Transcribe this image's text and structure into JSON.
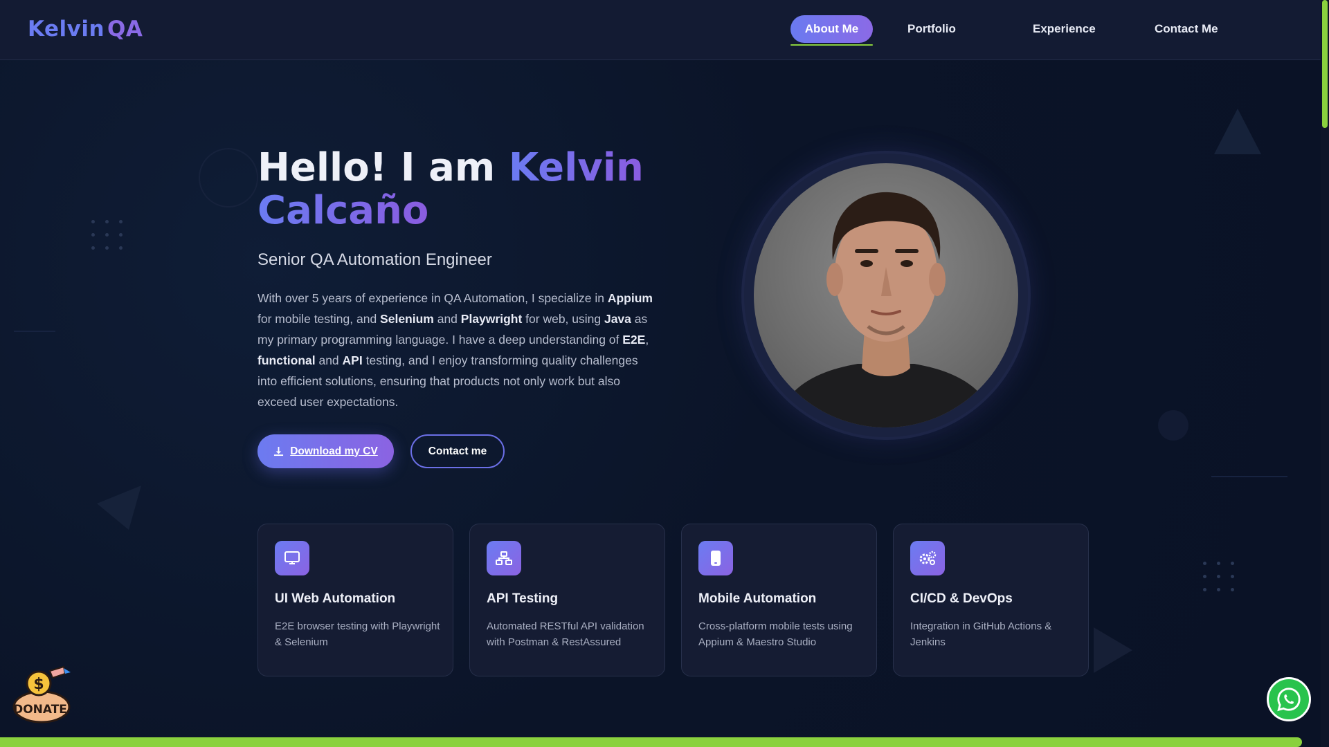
{
  "header": {
    "logo_part1": "Kelvin",
    "logo_part2": "QA",
    "nav": [
      {
        "label": "About Me",
        "active": true
      },
      {
        "label": "Portfolio",
        "active": false
      },
      {
        "label": "Experience",
        "active": false
      },
      {
        "label": "Contact Me",
        "active": false
      }
    ]
  },
  "hero": {
    "greeting": "Hello! I am ",
    "name_first": "Kelvin",
    "name_last": "Calcaño",
    "subtitle": "Senior QA Automation Engineer",
    "bio": [
      {
        "t": "With over 5 years of experience in QA Automation, I specialize in ",
        "b": false
      },
      {
        "t": "Appium",
        "b": true
      },
      {
        "t": " for mobile testing, and ",
        "b": false
      },
      {
        "t": "Selenium",
        "b": true
      },
      {
        "t": " and ",
        "b": false
      },
      {
        "t": "Playwright",
        "b": true
      },
      {
        "t": " for web, using ",
        "b": false
      },
      {
        "t": "Java",
        "b": true
      },
      {
        "t": " as my primary programming language. I have a deep understanding of ",
        "b": false
      },
      {
        "t": "E2E",
        "b": true
      },
      {
        "t": ", ",
        "b": false
      },
      {
        "t": "functional",
        "b": true
      },
      {
        "t": " and ",
        "b": false
      },
      {
        "t": "API",
        "b": true
      },
      {
        "t": " testing, and I enjoy transforming quality challenges into efficient solutions, ensuring that products not only work but also exceed user expectations.",
        "b": false
      }
    ],
    "download_cv_label": "Download my CV",
    "contact_label": "Contact me"
  },
  "services": [
    {
      "icon": "monitor-icon",
      "title": "UI Web Automation",
      "desc": "E2E browser testing with Playwright & Selenium"
    },
    {
      "icon": "network-icon",
      "title": "API Testing",
      "desc": "Automated RESTful API validation with Postman & RestAssured"
    },
    {
      "icon": "mobile-icon",
      "title": "Mobile Automation",
      "desc": "Cross-platform mobile tests using Appium & Maestro Studio"
    },
    {
      "icon": "gears-icon",
      "title": "CI/CD & DevOps",
      "desc": "Integration in GitHub Actions & Jenkins"
    }
  ],
  "donate_label": "DONATE",
  "colors": {
    "accent": "#6b7cf2",
    "accent2": "#8b63e2",
    "background": "#0b1428",
    "highlight": "#8ad13e",
    "whatsapp": "#28c34d"
  }
}
